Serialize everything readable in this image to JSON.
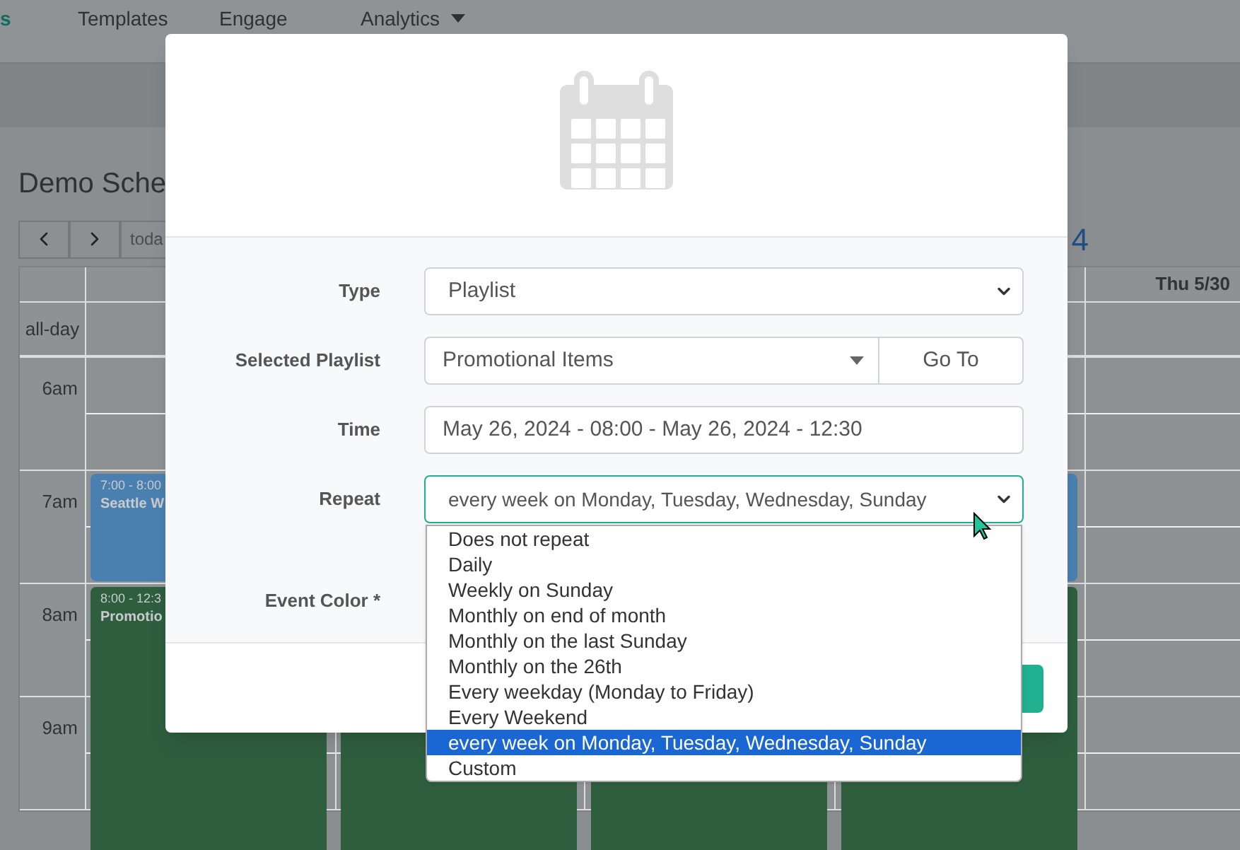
{
  "nav": [
    {
      "label": "s",
      "selected": true,
      "has_menu": false
    },
    {
      "label": "Templates",
      "selected": false,
      "has_menu": false
    },
    {
      "label": "Engage",
      "selected": false,
      "has_menu": false
    },
    {
      "label": "Analytics",
      "selected": false,
      "has_menu": true
    }
  ],
  "page_title": "Demo Sche",
  "toolbar": {
    "today": "toda",
    "range": "4"
  },
  "calendar": {
    "all_day": "all-day",
    "hours": [
      "6am",
      "7am",
      "8am",
      "9am"
    ],
    "days": [
      {
        "events": [
          {
            "kind": "short",
            "color": "#4a80b0",
            "time": "7:00 - 8:00",
            "title": "Seattle W"
          },
          {
            "kind": "long",
            "color": "#2f5e3f",
            "time": "8:00 - 12:3",
            "title": "Promotio"
          }
        ]
      },
      {
        "events": [
          {
            "kind": "long",
            "color": "#2f5e3f"
          }
        ]
      },
      {
        "events": [
          {
            "kind": "long",
            "color": "#2f5e3f"
          }
        ]
      },
      {
        "events": [
          {
            "kind": "short",
            "color": "#4a80b0"
          },
          {
            "kind": "long",
            "color": "#2f5e3f"
          }
        ]
      },
      {
        "header": "Thu 5/30"
      }
    ]
  },
  "modal": {
    "fields": [
      {
        "kind": "select",
        "label": "Type",
        "value": "Playlist"
      },
      {
        "kind": "combo",
        "label": "Selected Playlist",
        "value": "Promotional Items",
        "button": "Go To"
      },
      {
        "kind": "text",
        "label": "Time",
        "value": "May 26, 2024 - 08:00 - May 26, 2024 - 12:30"
      },
      {
        "kind": "open-select",
        "label": "Repeat",
        "value": "every week on Monday, Tuesday, Wednesday, Sunday",
        "options": [
          {
            "label": "Does not repeat",
            "selected": false
          },
          {
            "label": "Daily",
            "selected": false
          },
          {
            "label": "Weekly on Sunday",
            "selected": false
          },
          {
            "label": "Monthly on end of month",
            "selected": false
          },
          {
            "label": "Monthly on the last Sunday",
            "selected": false
          },
          {
            "label": "Monthly on the 26th",
            "selected": false
          },
          {
            "label": "Every weekday (Monday to Friday)",
            "selected": false
          },
          {
            "label": "Every Weekend",
            "selected": false
          },
          {
            "label": "every week on Monday, Tuesday, Wednesday, Sunday",
            "selected": true
          },
          {
            "label": "Custom",
            "selected": false
          }
        ]
      },
      {
        "kind": "hidden",
        "label": "Event Color *"
      }
    ]
  }
}
